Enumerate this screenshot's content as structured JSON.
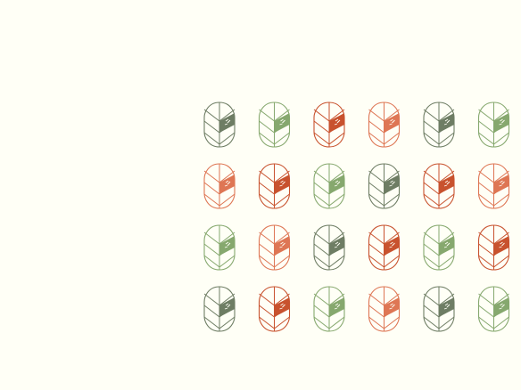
{
  "background_color": "#fffff6",
  "palette": {
    "dark_green": "#6e7d64",
    "light_green": "#86a86e",
    "dark_orange": "#c8522e",
    "light_orange": "#de7654"
  },
  "rows": [
    [
      "dark_green",
      "light_green",
      "dark_orange",
      "light_orange",
      "dark_green",
      "light_green"
    ],
    [
      "light_orange",
      "dark_orange",
      "light_green",
      "dark_green",
      "dark_orange",
      "light_orange"
    ],
    [
      "light_green",
      "light_orange",
      "dark_green",
      "dark_orange",
      "light_green",
      "dark_orange"
    ],
    [
      "dark_green",
      "dark_orange",
      "light_green",
      "light_orange",
      "dark_green",
      "light_green"
    ]
  ]
}
